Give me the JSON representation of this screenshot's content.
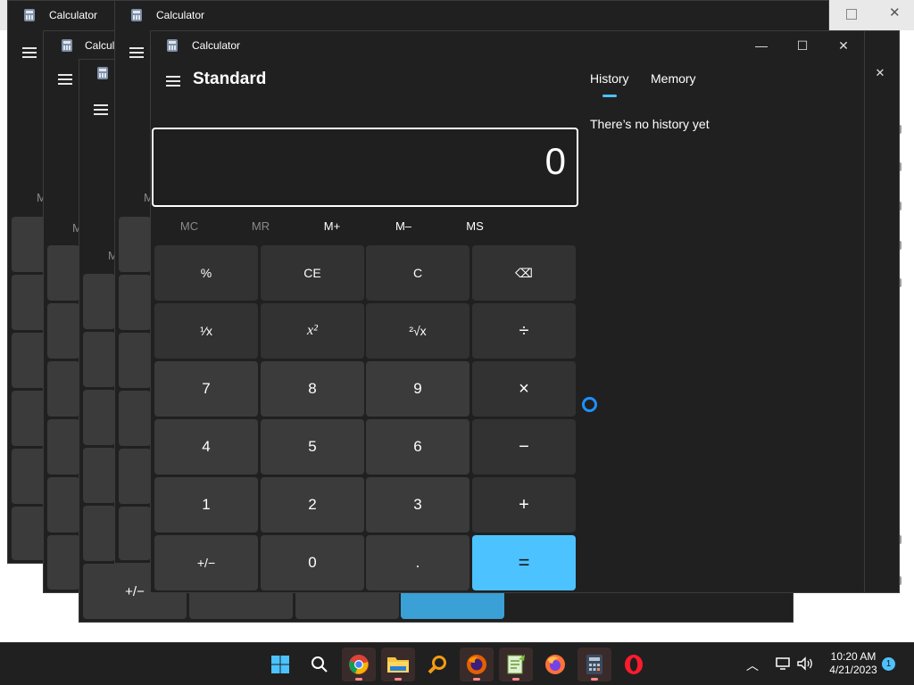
{
  "window": {
    "title": "Calculator",
    "mode": "Standard",
    "controls": {
      "minimize": "—",
      "maximize": "☐",
      "close": "✕"
    }
  },
  "background_windows": [
    {
      "title": "Calculator"
    },
    {
      "title": "Calculator"
    },
    {
      "title": "Calcul"
    },
    {
      "title": ""
    },
    {
      "title": ""
    }
  ],
  "display": {
    "value": "0"
  },
  "memory": [
    "MC",
    "MR",
    "M+",
    "M–",
    "MS"
  ],
  "keys": [
    [
      "%",
      "CE",
      "C",
      "⌫"
    ],
    [
      "¹⁄x",
      "x²",
      "²√x",
      "÷"
    ],
    [
      "7",
      "8",
      "9",
      "×"
    ],
    [
      "4",
      "5",
      "6",
      "−"
    ],
    [
      "1",
      "2",
      "3",
      "+"
    ],
    [
      "+/−",
      "0",
      ".",
      "="
    ]
  ],
  "panel": {
    "tabs": [
      "History",
      "Memory"
    ],
    "active_tab": "History",
    "empty_message": "There’s no history yet"
  },
  "background_labels": {
    "m": "M",
    "plus_minus": "+/−"
  },
  "taskbar": {
    "apps": [
      "start-icon",
      "search-icon",
      "chrome-icon",
      "file-explorer-icon",
      "search-everything-icon",
      "firefox-icon",
      "notepad-plus-icon",
      "firefox-dev-icon",
      "calculator-icon",
      "opera-icon"
    ],
    "time": "10:20 AM",
    "date": "4/21/2023",
    "notification_count": "1"
  },
  "colors": {
    "accent": "#4cc2ff",
    "window_bg": "#202020",
    "key_bg": "#3b3b3b",
    "taskbar_bg": "#202020"
  }
}
